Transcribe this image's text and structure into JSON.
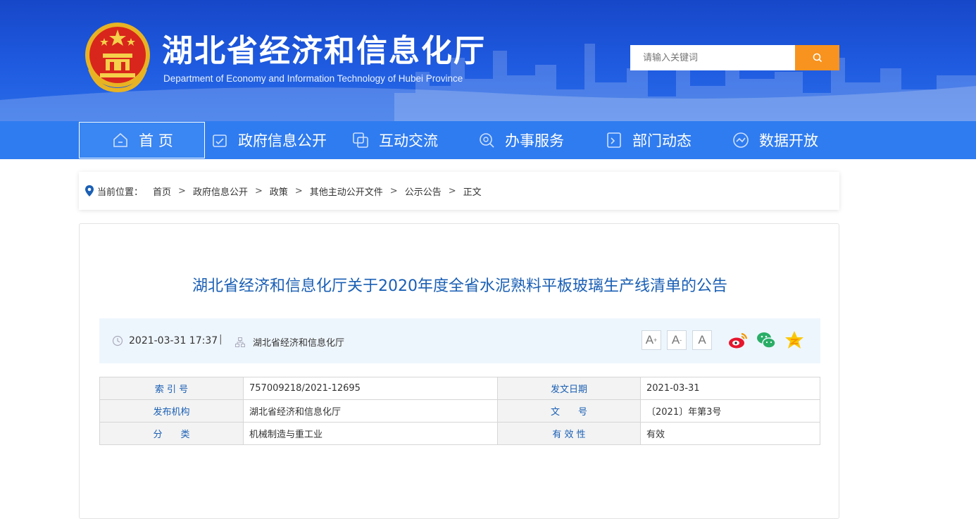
{
  "header": {
    "title": "湖北省经济和信息化厅",
    "subtitle": "Department of Economy and Information Technology of Hubei Province",
    "search_placeholder": "请输入关键词",
    "search_icon": "search-icon",
    "accent_color": "#f7931e",
    "bg_color": "#1f5be0"
  },
  "nav": {
    "items": [
      {
        "label": "首 页",
        "icon": "home-icon"
      },
      {
        "label": "政府信息公开",
        "icon": "document-icon"
      },
      {
        "label": "互动交流",
        "icon": "chat-icon"
      },
      {
        "label": "办事服务",
        "icon": "service-icon"
      },
      {
        "label": "部门动态",
        "icon": "news-icon"
      },
      {
        "label": "数据开放",
        "icon": "data-icon"
      }
    ],
    "active_index": 0
  },
  "breadcrumb": {
    "prefix": "当前位置：",
    "items": [
      "首页",
      "政府信息公开",
      "政策",
      "其他主动公开文件",
      "公示公告",
      "正文"
    ],
    "separator": ">"
  },
  "article": {
    "title": "湖北省经济和信息化厅关于2020年度全省水泥熟料平板玻璃生产线清单的公告",
    "date": "2021-03-31 17:37",
    "sep": "|",
    "source": "湖北省经济和信息化厅",
    "font_buttons": [
      "A",
      "A",
      "A"
    ],
    "share_icons": [
      "weibo-icon",
      "wechat-icon",
      "qzone-icon"
    ]
  },
  "info_table": {
    "rows": [
      [
        "索 引 号",
        "757009218/2021-12695",
        "发文日期",
        "2021-03-31"
      ],
      [
        "发布机构",
        "湖北省经济和信息化厅",
        "文　　号",
        "〔2021〕年第3号"
      ],
      [
        "分　　类",
        "机械制造与重工业",
        "有 效 性",
        "有效"
      ]
    ]
  }
}
